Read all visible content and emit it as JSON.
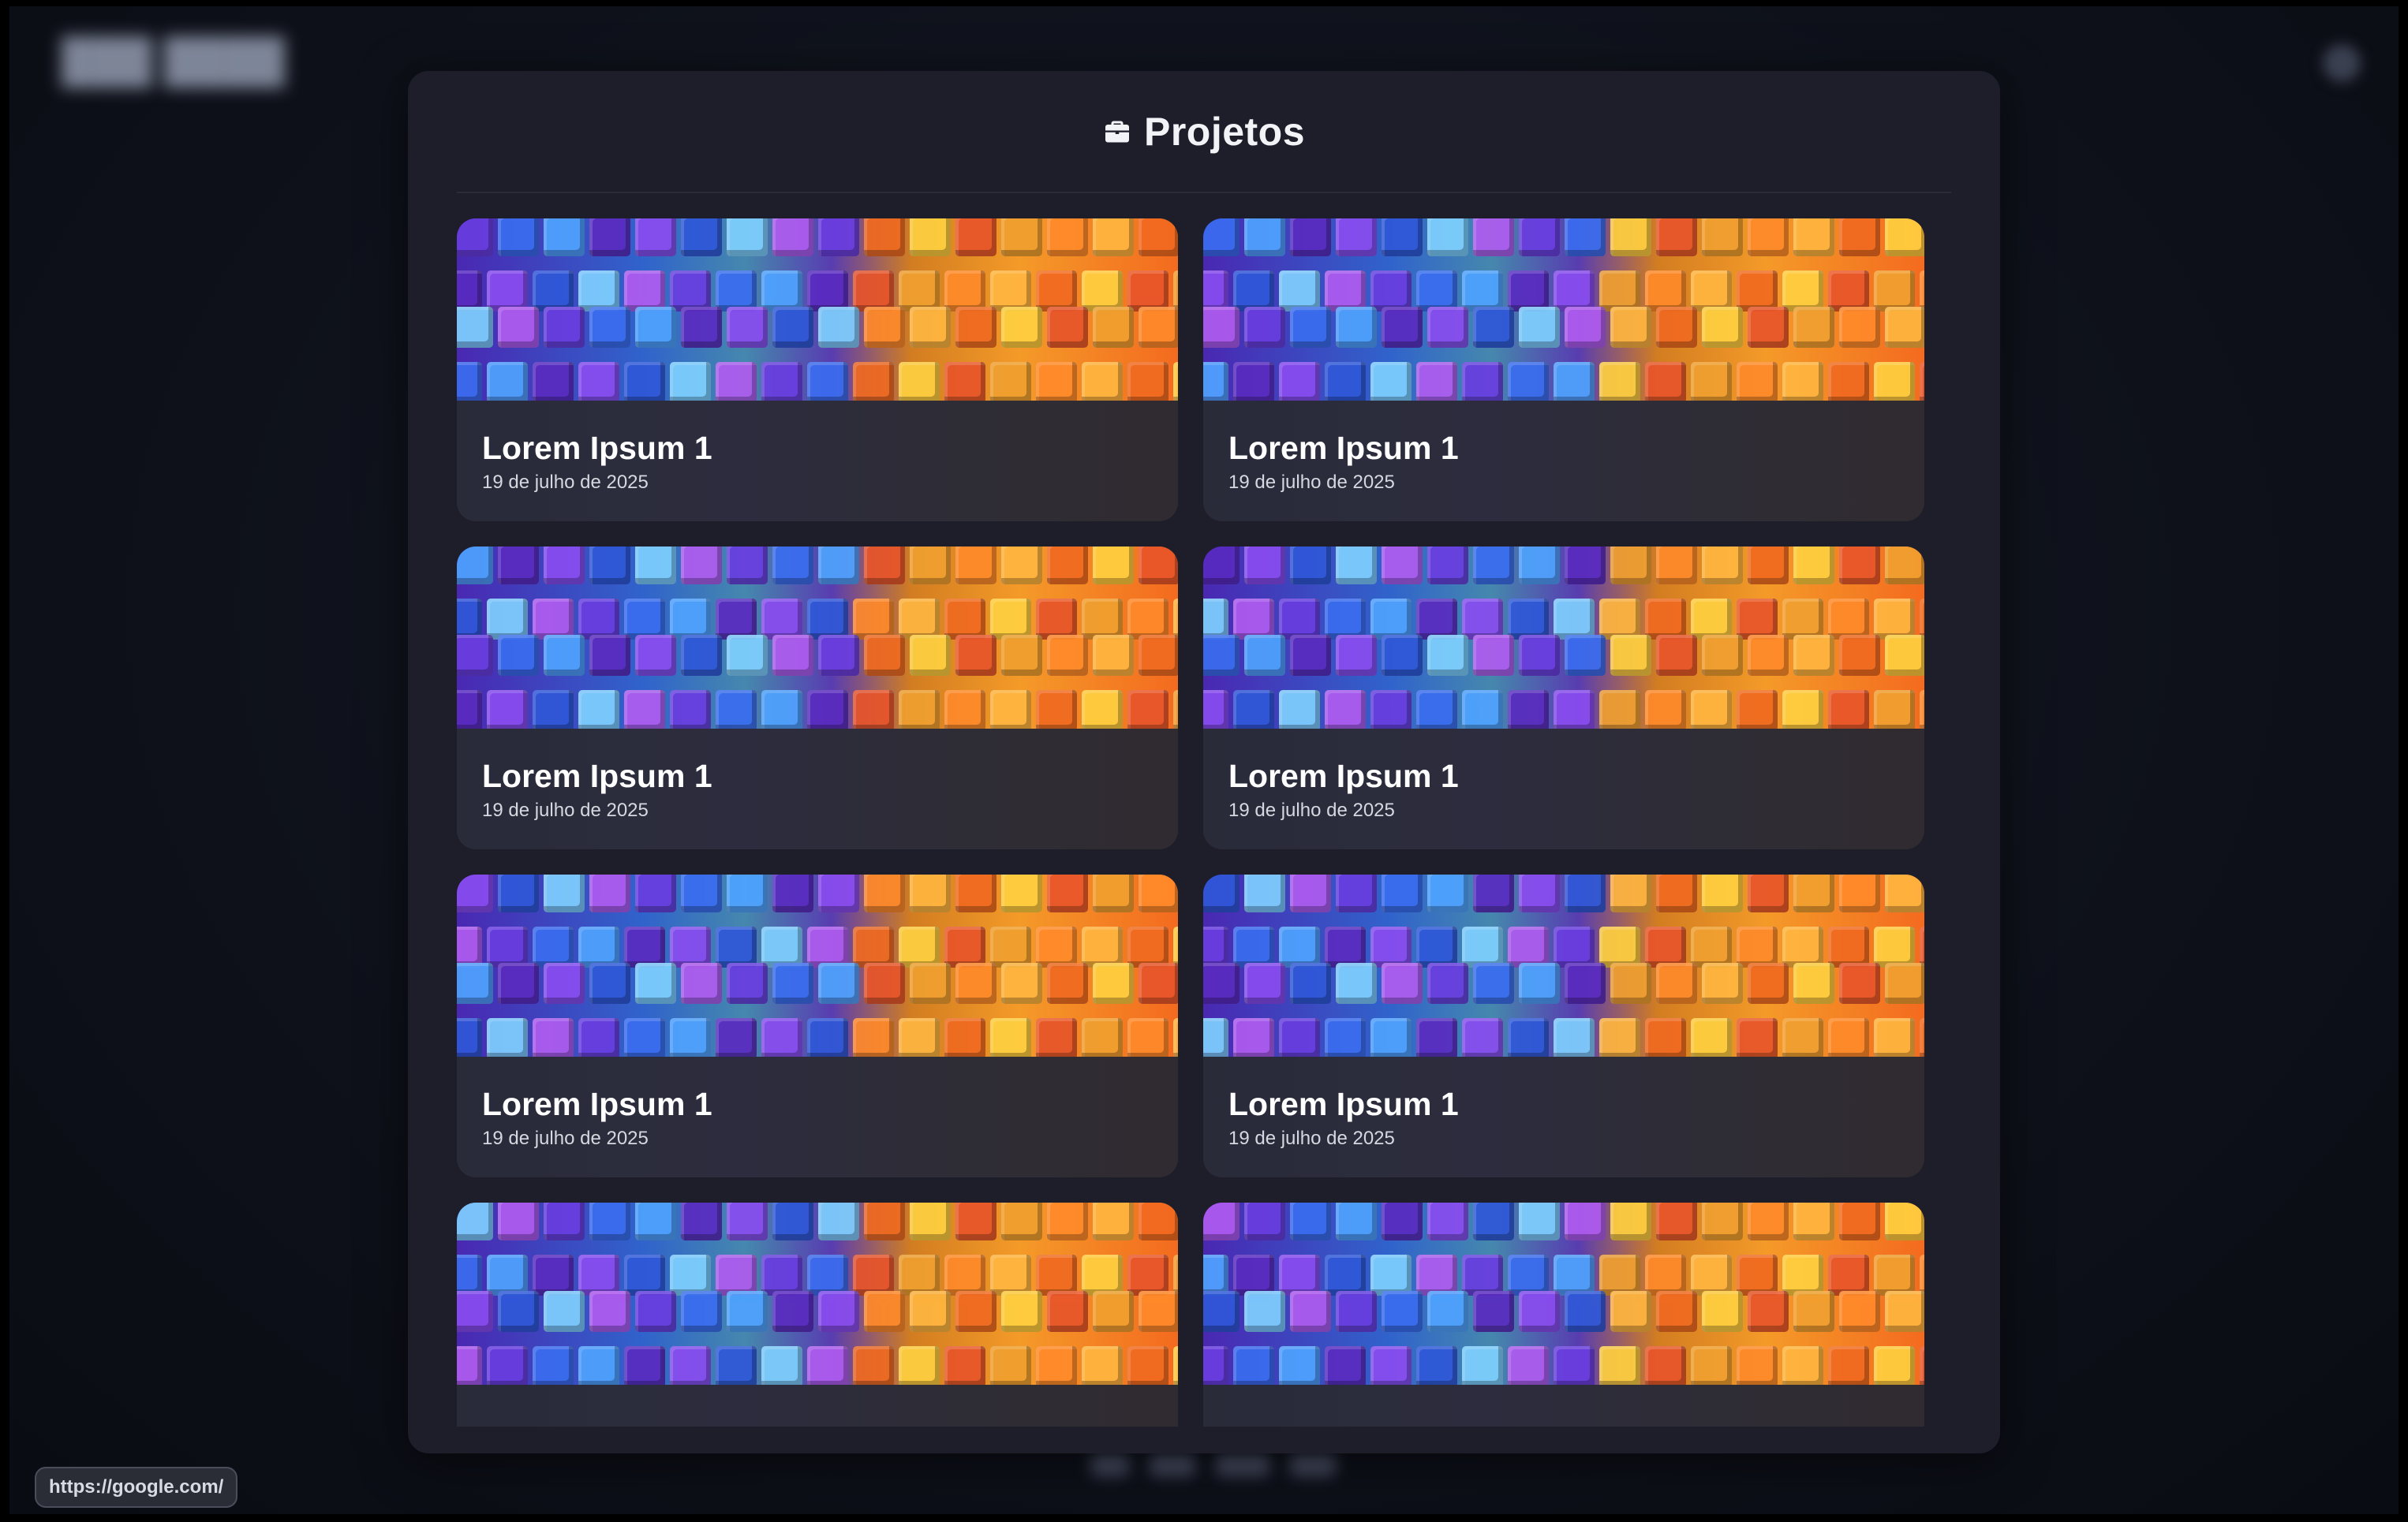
{
  "modal": {
    "title": "Projetos",
    "icon": "briefcase-icon"
  },
  "projects": [
    {
      "title": "Lorem Ipsum 1",
      "date": "19 de julho de 2025"
    },
    {
      "title": "Lorem Ipsum 1",
      "date": "19 de julho de 2025"
    },
    {
      "title": "Lorem Ipsum 1",
      "date": "19 de julho de 2025"
    },
    {
      "title": "Lorem Ipsum 1",
      "date": "19 de julho de 2025"
    },
    {
      "title": "Lorem Ipsum 1",
      "date": "19 de julho de 2025"
    },
    {
      "title": "Lorem Ipsum 1",
      "date": "19 de julho de 2025"
    },
    {
      "title": "",
      "date": ""
    },
    {
      "title": "",
      "date": ""
    }
  ],
  "status_bar": {
    "url": "https://google.com/"
  },
  "colors": {
    "modal_bg": "#1d1e2a",
    "page_bg": "#0e111a",
    "text_primary": "#ffffff",
    "text_secondary": "#d6d8e0"
  }
}
